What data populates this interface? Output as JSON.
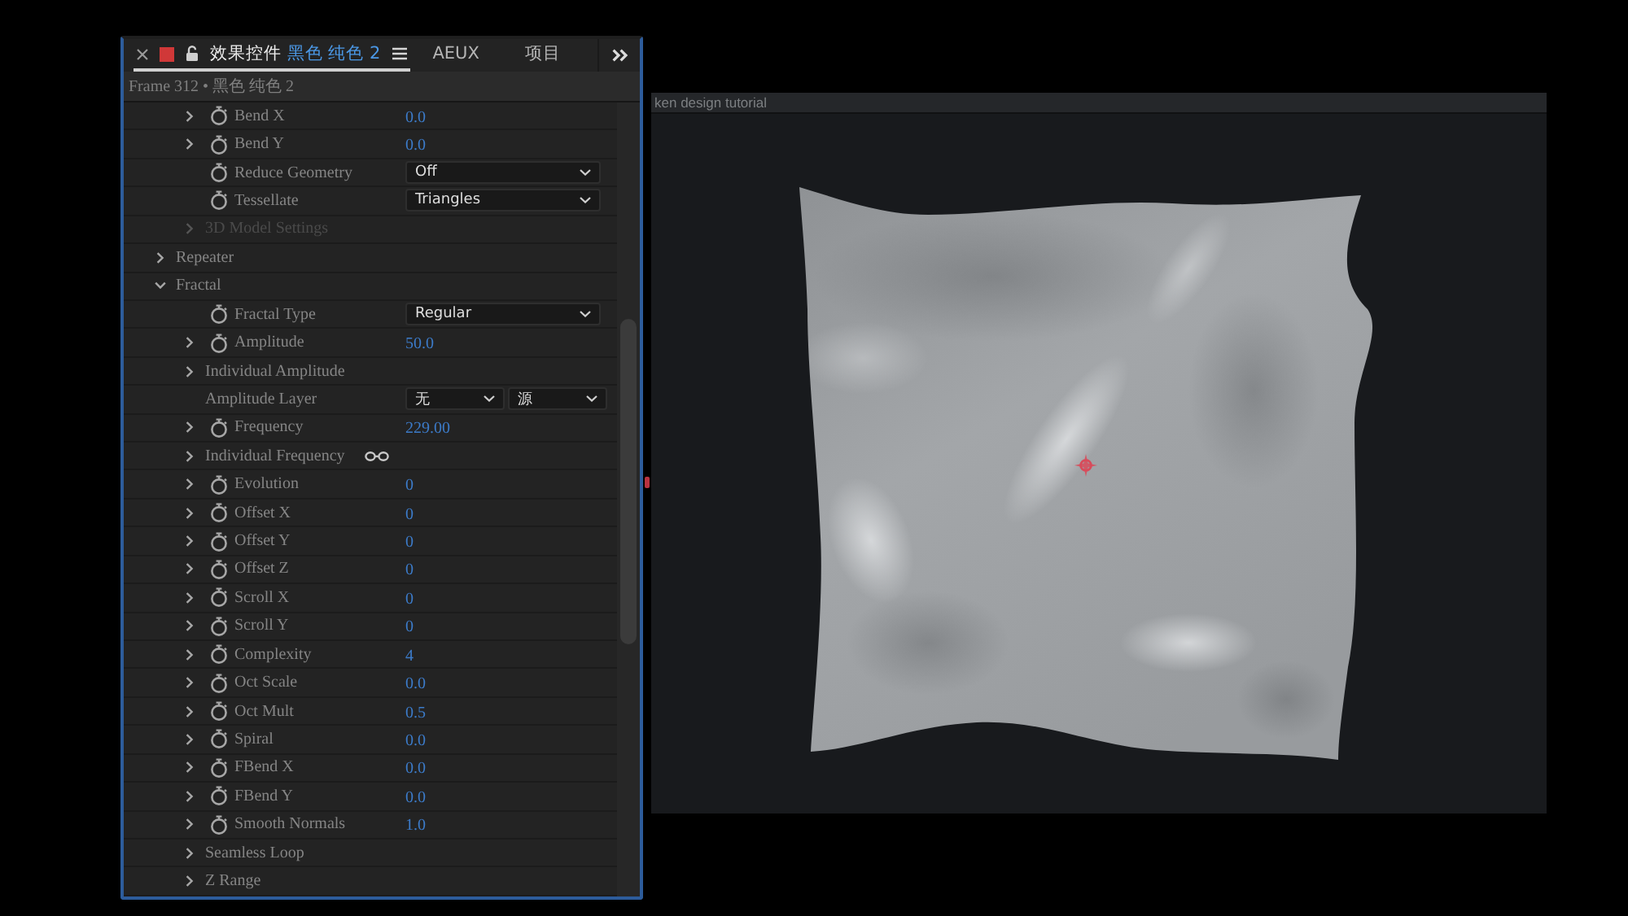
{
  "panel": {
    "tabs": [
      {
        "title": "效果控件",
        "subject": "黑色 纯色 2",
        "selected": true
      },
      {
        "title": "AEUX",
        "selected": false
      },
      {
        "title": "项目",
        "selected": false
      }
    ],
    "breadcrumb": "Frame 312 • 黑色 纯色 2",
    "tree": [
      {
        "children": [
          {
            "label": "Bend X",
            "kind": "number",
            "value": "0.0",
            "expanded": false,
            "disabled": false
          },
          {
            "label": "Bend Y",
            "kind": "number",
            "value": "0.0",
            "expanded": false,
            "disabled": false
          },
          {
            "label": "Reduce Geometry",
            "kind": "menu",
            "option": "Off",
            "disabled": false
          },
          {
            "label": "Tessellate",
            "kind": "menu",
            "option": "Triangles",
            "disabled": false
          },
          {
            "label": "3D Model Settings",
            "kind": "group",
            "expanded": false,
            "disabled": true
          }
        ]
      },
      {
        "label": "Repeater",
        "expanded": false,
        "disabled": false
      },
      {
        "label": "Fractal",
        "expanded": true,
        "disabled": false,
        "children": [
          {
            "label": "Fractal Type",
            "kind": "menu",
            "option": "Regular",
            "disabled": false
          },
          {
            "label": "Amplitude",
            "kind": "number",
            "value": "50.0",
            "expanded": false,
            "disabled": false
          },
          {
            "label": "Individual Amplitude",
            "kind": "group",
            "expanded": false,
            "disabled": false
          },
          {
            "label": "Amplitude Layer",
            "kind": "layer",
            "options": [
              "无",
              "源"
            ],
            "disabled": false
          },
          {
            "label": "Frequency",
            "kind": "number",
            "value": "229.00",
            "expanded": false,
            "disabled": false
          },
          {
            "label": "Individual Frequency",
            "kind": "linked_group",
            "expanded": false,
            "disabled": false
          },
          {
            "label": "Evolution",
            "kind": "number",
            "value": "0",
            "expanded": false,
            "disabled": false
          },
          {
            "label": "Offset X",
            "kind": "number",
            "value": "0",
            "expanded": false,
            "disabled": false
          },
          {
            "label": "Offset Y",
            "kind": "number",
            "value": "0",
            "expanded": false,
            "disabled": false
          },
          {
            "label": "Offset Z",
            "kind": "number",
            "value": "0",
            "expanded": false,
            "disabled": false
          },
          {
            "label": "Scroll X",
            "kind": "number",
            "value": "0",
            "expanded": false,
            "disabled": false
          },
          {
            "label": "Scroll Y",
            "kind": "number",
            "value": "0",
            "expanded": false,
            "disabled": false
          },
          {
            "label": "Complexity",
            "kind": "number",
            "value": "4",
            "expanded": false,
            "disabled": false
          },
          {
            "label": "Oct Scale",
            "kind": "number",
            "value": "0.0",
            "expanded": false,
            "disabled": false
          },
          {
            "label": "Oct Mult",
            "kind": "number",
            "value": "0.5",
            "expanded": false,
            "disabled": false
          },
          {
            "label": "Spiral",
            "kind": "number",
            "value": "0.0",
            "expanded": false,
            "disabled": false
          },
          {
            "label": "FBend X",
            "kind": "number",
            "value": "0.0",
            "expanded": false,
            "disabled": false
          },
          {
            "label": "FBend Y",
            "kind": "number",
            "value": "0.0",
            "expanded": false,
            "disabled": false
          },
          {
            "label": "Smooth Normals",
            "kind": "number",
            "value": "1.0",
            "expanded": false,
            "disabled": false
          },
          {
            "label": "Seamless Loop",
            "kind": "group",
            "expanded": false,
            "disabled": false
          },
          {
            "label": "Z Range",
            "kind": "group",
            "expanded": false,
            "disabled": false
          }
        ]
      }
    ]
  },
  "viewer": {
    "title": "ken design tutorial"
  }
}
